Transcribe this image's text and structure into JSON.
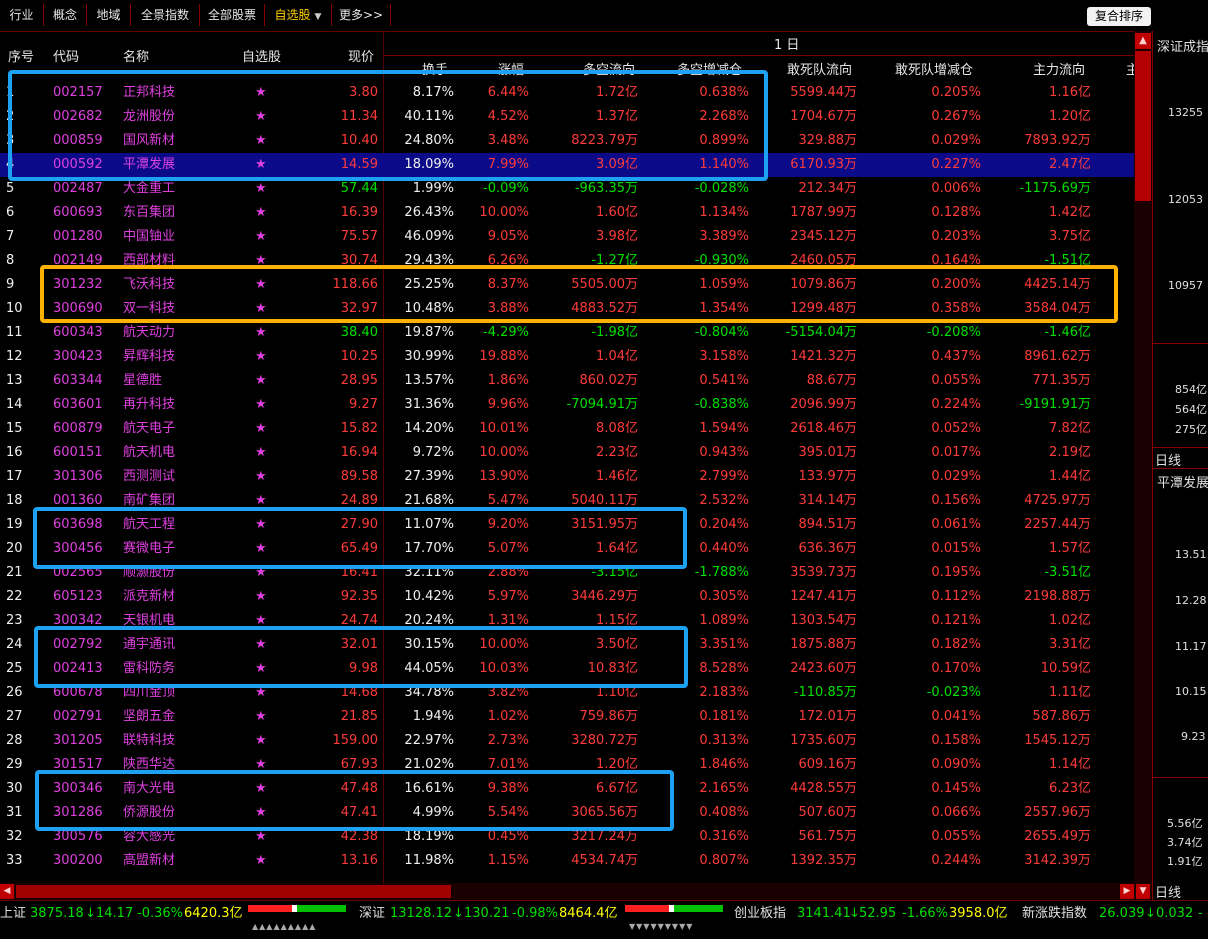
{
  "tabs": [
    {
      "label": "行业",
      "active": false,
      "caret": false
    },
    {
      "label": "概念",
      "active": false,
      "caret": false
    },
    {
      "label": "地域",
      "active": false,
      "caret": false
    },
    {
      "label": "全景指数",
      "active": false,
      "caret": false
    },
    {
      "label": "全部股票",
      "active": false,
      "caret": false
    },
    {
      "label": "自选股",
      "active": true,
      "caret": true
    },
    {
      "label": "更多>>",
      "active": false,
      "caret": false
    }
  ],
  "sort_button": "复合排序",
  "period_label": "1  日",
  "headers": {
    "idx": "序号",
    "code": "代码",
    "name": "名称",
    "watch": "自选股",
    "price": "现价",
    "turnover": "换手",
    "change": "涨幅",
    "flow": "多空流向",
    "flow_chg": "多空增减仓",
    "dsq": "敢死队流向",
    "dsq_chg": "敢死队增减仓",
    "main": "主力流向",
    "more": "主"
  },
  "star": "★",
  "rows": [
    {
      "idx": "1",
      "code": "002157",
      "name": "正邦科技",
      "price": "3.80",
      "turnover": "8.17%",
      "change": "6.44%",
      "flow": "1.72亿",
      "flow_chg": "0.638%",
      "dsq": "5599.44万",
      "dsq_chg": "0.205%",
      "main": "1.16亿",
      "dir": "up",
      "flow_dir": "up",
      "fchg_dir": "up",
      "dsq_dir": "up",
      "dsqc_dir": "up",
      "main_dir": "up"
    },
    {
      "idx": "2",
      "code": "002682",
      "name": "龙洲股份",
      "price": "11.34",
      "turnover": "40.11%",
      "change": "4.52%",
      "flow": "1.37亿",
      "flow_chg": "2.268%",
      "dsq": "1704.67万",
      "dsq_chg": "0.267%",
      "main": "1.20亿",
      "dir": "up",
      "flow_dir": "up",
      "fchg_dir": "up",
      "dsq_dir": "up",
      "dsqc_dir": "up",
      "main_dir": "up"
    },
    {
      "idx": "3",
      "code": "000859",
      "name": "国风新材",
      "price": "10.40",
      "turnover": "24.80%",
      "change": "3.48%",
      "flow": "8223.79万",
      "flow_chg": "0.899%",
      "dsq": "329.88万",
      "dsq_chg": "0.029%",
      "main": "7893.92万",
      "dir": "up",
      "flow_dir": "up",
      "fchg_dir": "up",
      "dsq_dir": "up",
      "dsqc_dir": "up",
      "main_dir": "up"
    },
    {
      "idx": "4",
      "code": "000592",
      "name": "平潭发展",
      "price": "14.59",
      "turnover": "18.09%",
      "change": "7.99%",
      "flow": "3.09亿",
      "flow_chg": "1.140%",
      "dsq": "6170.93万",
      "dsq_chg": "0.227%",
      "main": "2.47亿",
      "dir": "up",
      "flow_dir": "up",
      "fchg_dir": "up",
      "dsq_dir": "up",
      "dsqc_dir": "up",
      "main_dir": "up",
      "selected": true
    },
    {
      "idx": "5",
      "code": "002487",
      "name": "大金重工",
      "price": "57.44",
      "turnover": "1.99%",
      "change": "-0.09%",
      "flow": "-963.35万",
      "flow_chg": "-0.028%",
      "dsq": "212.34万",
      "dsq_chg": "0.006%",
      "main": "-1175.69万",
      "dir": "dn",
      "flow_dir": "dn",
      "fchg_dir": "dn",
      "dsq_dir": "up",
      "dsqc_dir": "up",
      "main_dir": "dn"
    },
    {
      "idx": "6",
      "code": "600693",
      "name": "东百集团",
      "price": "16.39",
      "turnover": "26.43%",
      "change": "10.00%",
      "flow": "1.60亿",
      "flow_chg": "1.134%",
      "dsq": "1787.99万",
      "dsq_chg": "0.128%",
      "main": "1.42亿",
      "dir": "up",
      "flow_dir": "up",
      "fchg_dir": "up",
      "dsq_dir": "up",
      "dsqc_dir": "up",
      "main_dir": "up"
    },
    {
      "idx": "7",
      "code": "001280",
      "name": "中国铀业",
      "price": "75.57",
      "turnover": "46.09%",
      "change": "9.05%",
      "flow": "3.98亿",
      "flow_chg": "3.389%",
      "dsq": "2345.12万",
      "dsq_chg": "0.203%",
      "main": "3.75亿",
      "dir": "up",
      "flow_dir": "up",
      "fchg_dir": "up",
      "dsq_dir": "up",
      "dsqc_dir": "up",
      "main_dir": "up"
    },
    {
      "idx": "8",
      "code": "002149",
      "name": "西部材料",
      "price": "30.74",
      "turnover": "29.43%",
      "change": "6.26%",
      "flow": "-1.27亿",
      "flow_chg": "-0.930%",
      "dsq": "2460.05万",
      "dsq_chg": "0.164%",
      "main": "-1.51亿",
      "dir": "up",
      "flow_dir": "dn",
      "fchg_dir": "dn",
      "dsq_dir": "up",
      "dsqc_dir": "up",
      "main_dir": "dn"
    },
    {
      "idx": "9",
      "code": "301232",
      "name": "飞沃科技",
      "price": "118.66",
      "turnover": "25.25%",
      "change": "8.37%",
      "flow": "5505.00万",
      "flow_chg": "1.059%",
      "dsq": "1079.86万",
      "dsq_chg": "0.200%",
      "main": "4425.14万",
      "dir": "up",
      "flow_dir": "up",
      "fchg_dir": "up",
      "dsq_dir": "up",
      "dsqc_dir": "up",
      "main_dir": "up"
    },
    {
      "idx": "10",
      "code": "300690",
      "name": "双一科技",
      "price": "32.97",
      "turnover": "10.48%",
      "change": "3.88%",
      "flow": "4883.52万",
      "flow_chg": "1.354%",
      "dsq": "1299.48万",
      "dsq_chg": "0.358%",
      "main": "3584.04万",
      "dir": "up",
      "flow_dir": "up",
      "fchg_dir": "up",
      "dsq_dir": "up",
      "dsqc_dir": "up",
      "main_dir": "up"
    },
    {
      "idx": "11",
      "code": "600343",
      "name": "航天动力",
      "price": "38.40",
      "turnover": "19.87%",
      "change": "-4.29%",
      "flow": "-1.98亿",
      "flow_chg": "-0.804%",
      "dsq": "-5154.04万",
      "dsq_chg": "-0.208%",
      "main": "-1.46亿",
      "dir": "dn",
      "flow_dir": "dn",
      "fchg_dir": "dn",
      "dsq_dir": "dn",
      "dsqc_dir": "dn",
      "main_dir": "dn"
    },
    {
      "idx": "12",
      "code": "300423",
      "name": "昇辉科技",
      "price": "10.25",
      "turnover": "30.99%",
      "change": "19.88%",
      "flow": "1.04亿",
      "flow_chg": "3.158%",
      "dsq": "1421.32万",
      "dsq_chg": "0.437%",
      "main": "8961.62万",
      "dir": "up",
      "flow_dir": "up",
      "fchg_dir": "up",
      "dsq_dir": "up",
      "dsqc_dir": "up",
      "main_dir": "up"
    },
    {
      "idx": "13",
      "code": "603344",
      "name": "星德胜",
      "price": "28.95",
      "turnover": "13.57%",
      "change": "1.86%",
      "flow": "860.02万",
      "flow_chg": "0.541%",
      "dsq": "88.67万",
      "dsq_chg": "0.055%",
      "main": "771.35万",
      "dir": "up",
      "flow_dir": "up",
      "fchg_dir": "up",
      "dsq_dir": "up",
      "dsqc_dir": "up",
      "main_dir": "up"
    },
    {
      "idx": "14",
      "code": "603601",
      "name": "再升科技",
      "price": "9.27",
      "turnover": "31.36%",
      "change": "9.96%",
      "flow": "-7094.91万",
      "flow_chg": "-0.838%",
      "dsq": "2096.99万",
      "dsq_chg": "0.224%",
      "main": "-9191.91万",
      "dir": "up",
      "flow_dir": "dn",
      "fchg_dir": "dn",
      "dsq_dir": "up",
      "dsqc_dir": "up",
      "main_dir": "dn"
    },
    {
      "idx": "15",
      "code": "600879",
      "name": "航天电子",
      "price": "15.82",
      "turnover": "14.20%",
      "change": "10.01%",
      "flow": "8.08亿",
      "flow_chg": "1.594%",
      "dsq": "2618.46万",
      "dsq_chg": "0.052%",
      "main": "7.82亿",
      "dir": "up",
      "flow_dir": "up",
      "fchg_dir": "up",
      "dsq_dir": "up",
      "dsqc_dir": "up",
      "main_dir": "up"
    },
    {
      "idx": "16",
      "code": "600151",
      "name": "航天机电",
      "price": "16.94",
      "turnover": "9.72%",
      "change": "10.00%",
      "flow": "2.23亿",
      "flow_chg": "0.943%",
      "dsq": "395.01万",
      "dsq_chg": "0.017%",
      "main": "2.19亿",
      "dir": "up",
      "flow_dir": "up",
      "fchg_dir": "up",
      "dsq_dir": "up",
      "dsqc_dir": "up",
      "main_dir": "up"
    },
    {
      "idx": "17",
      "code": "301306",
      "name": "西测测试",
      "price": "89.58",
      "turnover": "27.39%",
      "change": "13.90%",
      "flow": "1.46亿",
      "flow_chg": "2.799%",
      "dsq": "133.97万",
      "dsq_chg": "0.029%",
      "main": "1.44亿",
      "dir": "up",
      "flow_dir": "up",
      "fchg_dir": "up",
      "dsq_dir": "up",
      "dsqc_dir": "up",
      "main_dir": "up"
    },
    {
      "idx": "18",
      "code": "001360",
      "name": "南矿集团",
      "price": "24.89",
      "turnover": "21.68%",
      "change": "5.47%",
      "flow": "5040.11万",
      "flow_chg": "2.532%",
      "dsq": "314.14万",
      "dsq_chg": "0.156%",
      "main": "4725.97万",
      "dir": "up",
      "flow_dir": "up",
      "fchg_dir": "up",
      "dsq_dir": "up",
      "dsqc_dir": "up",
      "main_dir": "up"
    },
    {
      "idx": "19",
      "code": "603698",
      "name": "航天工程",
      "price": "27.90",
      "turnover": "11.07%",
      "change": "9.20%",
      "flow": "3151.95万",
      "flow_chg": "0.204%",
      "dsq": "894.51万",
      "dsq_chg": "0.061%",
      "main": "2257.44万",
      "dir": "up",
      "flow_dir": "up",
      "fchg_dir": "up",
      "dsq_dir": "up",
      "dsqc_dir": "up",
      "main_dir": "up"
    },
    {
      "idx": "20",
      "code": "300456",
      "name": "赛微电子",
      "price": "65.49",
      "turnover": "17.70%",
      "change": "5.07%",
      "flow": "1.64亿",
      "flow_chg": "0.440%",
      "dsq": "636.36万",
      "dsq_chg": "0.015%",
      "main": "1.57亿",
      "dir": "up",
      "flow_dir": "up",
      "fchg_dir": "up",
      "dsq_dir": "up",
      "dsqc_dir": "up",
      "main_dir": "up"
    },
    {
      "idx": "21",
      "code": "002565",
      "name": "顺灏股份",
      "price": "16.41",
      "turnover": "32.11%",
      "change": "2.88%",
      "flow": "-3.15亿",
      "flow_chg": "-1.788%",
      "dsq": "3539.73万",
      "dsq_chg": "0.195%",
      "main": "-3.51亿",
      "dir": "up",
      "flow_dir": "dn",
      "fchg_dir": "dn",
      "dsq_dir": "up",
      "dsqc_dir": "up",
      "main_dir": "dn"
    },
    {
      "idx": "22",
      "code": "605123",
      "name": "派克新材",
      "price": "92.35",
      "turnover": "10.42%",
      "change": "5.97%",
      "flow": "3446.29万",
      "flow_chg": "0.305%",
      "dsq": "1247.41万",
      "dsq_chg": "0.112%",
      "main": "2198.88万",
      "dir": "up",
      "flow_dir": "up",
      "fchg_dir": "up",
      "dsq_dir": "up",
      "dsqc_dir": "up",
      "main_dir": "up"
    },
    {
      "idx": "23",
      "code": "300342",
      "name": "天银机电",
      "price": "24.74",
      "turnover": "20.24%",
      "change": "1.31%",
      "flow": "1.15亿",
      "flow_chg": "1.089%",
      "dsq": "1303.54万",
      "dsq_chg": "0.121%",
      "main": "1.02亿",
      "dir": "up",
      "flow_dir": "up",
      "fchg_dir": "up",
      "dsq_dir": "up",
      "dsqc_dir": "up",
      "main_dir": "up"
    },
    {
      "idx": "24",
      "code": "002792",
      "name": "通宇通讯",
      "price": "32.01",
      "turnover": "30.15%",
      "change": "10.00%",
      "flow": "3.50亿",
      "flow_chg": "3.351%",
      "dsq": "1875.88万",
      "dsq_chg": "0.182%",
      "main": "3.31亿",
      "dir": "up",
      "flow_dir": "up",
      "fchg_dir": "up",
      "dsq_dir": "up",
      "dsqc_dir": "up",
      "main_dir": "up"
    },
    {
      "idx": "25",
      "code": "002413",
      "name": "雷科防务",
      "price": "9.98",
      "turnover": "44.05%",
      "change": "10.03%",
      "flow": "10.83亿",
      "flow_chg": "8.528%",
      "dsq": "2423.60万",
      "dsq_chg": "0.170%",
      "main": "10.59亿",
      "dir": "up",
      "flow_dir": "up",
      "fchg_dir": "up",
      "dsq_dir": "up",
      "dsqc_dir": "up",
      "main_dir": "up"
    },
    {
      "idx": "26",
      "code": "600678",
      "name": "四川金顶",
      "price": "14.68",
      "turnover": "34.78%",
      "change": "3.82%",
      "flow": "1.10亿",
      "flow_chg": "2.183%",
      "dsq": "-110.85万",
      "dsq_chg": "-0.023%",
      "main": "1.11亿",
      "dir": "up",
      "flow_dir": "up",
      "fchg_dir": "up",
      "dsq_dir": "dn",
      "dsqc_dir": "dn",
      "main_dir": "up"
    },
    {
      "idx": "27",
      "code": "002791",
      "name": "坚朗五金",
      "price": "21.85",
      "turnover": "1.94%",
      "change": "1.02%",
      "flow": "759.86万",
      "flow_chg": "0.181%",
      "dsq": "172.01万",
      "dsq_chg": "0.041%",
      "main": "587.86万",
      "dir": "up",
      "flow_dir": "up",
      "fchg_dir": "up",
      "dsq_dir": "up",
      "dsqc_dir": "up",
      "main_dir": "up"
    },
    {
      "idx": "28",
      "code": "301205",
      "name": "联特科技",
      "price": "159.00",
      "turnover": "22.97%",
      "change": "2.73%",
      "flow": "3280.72万",
      "flow_chg": "0.313%",
      "dsq": "1735.60万",
      "dsq_chg": "0.158%",
      "main": "1545.12万",
      "dir": "up",
      "flow_dir": "up",
      "fchg_dir": "up",
      "dsq_dir": "up",
      "dsqc_dir": "up",
      "main_dir": "up"
    },
    {
      "idx": "29",
      "code": "301517",
      "name": "陕西华达",
      "price": "67.93",
      "turnover": "21.02%",
      "change": "7.01%",
      "flow": "1.20亿",
      "flow_chg": "1.846%",
      "dsq": "609.16万",
      "dsq_chg": "0.090%",
      "main": "1.14亿",
      "dir": "up",
      "flow_dir": "up",
      "fchg_dir": "up",
      "dsq_dir": "up",
      "dsqc_dir": "up",
      "main_dir": "up"
    },
    {
      "idx": "30",
      "code": "300346",
      "name": "南大光电",
      "price": "47.48",
      "turnover": "16.61%",
      "change": "9.38%",
      "flow": "6.67亿",
      "flow_chg": "2.165%",
      "dsq": "4428.55万",
      "dsq_chg": "0.145%",
      "main": "6.23亿",
      "dir": "up",
      "flow_dir": "up",
      "fchg_dir": "up",
      "dsq_dir": "up",
      "dsqc_dir": "up",
      "main_dir": "up"
    },
    {
      "idx": "31",
      "code": "301286",
      "name": "侨源股份",
      "price": "47.41",
      "turnover": "4.99%",
      "change": "5.54%",
      "flow": "3065.56万",
      "flow_chg": "0.408%",
      "dsq": "507.60万",
      "dsq_chg": "0.066%",
      "main": "2557.96万",
      "dir": "up",
      "flow_dir": "up",
      "fchg_dir": "up",
      "dsq_dir": "up",
      "dsqc_dir": "up",
      "main_dir": "up"
    },
    {
      "idx": "32",
      "code": "300576",
      "name": "容大感光",
      "price": "42.38",
      "turnover": "18.19%",
      "change": "0.45%",
      "flow": "3217.24万",
      "flow_chg": "0.316%",
      "dsq": "561.75万",
      "dsq_chg": "0.055%",
      "main": "2655.49万",
      "dir": "up",
      "flow_dir": "up",
      "fchg_dir": "up",
      "dsq_dir": "up",
      "dsqc_dir": "up",
      "main_dir": "up"
    },
    {
      "idx": "33",
      "code": "300200",
      "name": "高盟新材",
      "price": "13.16",
      "turnover": "11.98%",
      "change": "1.15%",
      "flow": "4534.74万",
      "flow_chg": "0.807%",
      "dsq": "1392.35万",
      "dsq_chg": "0.244%",
      "main": "3142.39万",
      "dir": "up",
      "flow_dir": "up",
      "fchg_dir": "up",
      "dsq_dir": "up",
      "dsqc_dir": "up",
      "main_dir": "up"
    }
  ],
  "right_panel": {
    "title": "深证成指",
    "ticks": [
      "13255",
      "12053",
      "10957"
    ],
    "volumes": [
      "854亿",
      "564亿",
      "275亿"
    ],
    "kline_tab": "日线",
    "stock_name": "平潭发展",
    "prices": [
      "13.51",
      "12.28",
      "11.17",
      "10.15",
      "9.23"
    ],
    "lower_volumes": [
      "5.56亿",
      "3.74亿",
      "1.91亿"
    ],
    "bottom_tab": "日线"
  },
  "status": {
    "sh_label": "上证",
    "sh_index": "3875.18",
    "sh_arrow": "↓",
    "sh_chg": "14.17",
    "sh_pct": "-0.36%",
    "sh_amt": "6420.3亿",
    "sh_bar": {
      "up": 0.45,
      "flat": 0.05,
      "down": 0.5
    },
    "sz_label": "深证",
    "sz_index": "13128.12",
    "sz_arrow": "↓",
    "sz_chg": "130.21",
    "sz_pct": "-0.98%",
    "sz_amt": "8464.4亿",
    "sz_bar": {
      "up": 0.45,
      "flat": 0.05,
      "down": 0.5
    },
    "cy_label": "创业板指",
    "cy_index": "3141.41",
    "cy_arrow": "↓",
    "cy_chg": "52.95",
    "cy_pct": "-1.66%",
    "cy_amt": "3958.0亿",
    "xz_label": "新涨跌指数",
    "xz_index": "26.039",
    "xz_arrow": "↓",
    "xz_chg": "0.032",
    "xz_tail": "-"
  },
  "colors": {
    "up": "#ff3b3b",
    "down": "#00e000",
    "code": "#e040e0",
    "highlight_blue": "#1da1f2",
    "highlight_orange": "#ffb300",
    "selected_row": "#0b0b8a"
  }
}
